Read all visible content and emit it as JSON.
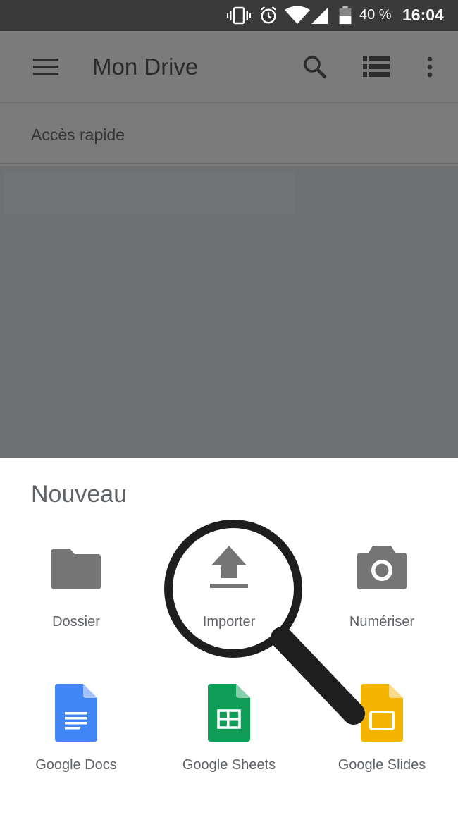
{
  "status_bar": {
    "battery_percent": "40 %",
    "time": "16:04",
    "icons": [
      "vibrate-icon",
      "alarm-icon",
      "wifi-icon",
      "cell-signal-icon",
      "battery-icon"
    ]
  },
  "toolbar": {
    "title": "Mon Drive",
    "icons": [
      "menu-icon",
      "search-icon",
      "list-view-icon",
      "more-vert-icon"
    ]
  },
  "quick_access": {
    "label": "Accès rapide"
  },
  "sheet": {
    "heading": "Nouveau",
    "options": [
      {
        "label": "Dossier",
        "icon": "folder-icon"
      },
      {
        "label": "Importer",
        "icon": "upload-icon"
      },
      {
        "label": "Numériser",
        "icon": "camera-icon"
      },
      {
        "label": "Google Docs",
        "icon": "google-docs-icon"
      },
      {
        "label": "Google Sheets",
        "icon": "google-sheets-icon"
      },
      {
        "label": "Google Slides",
        "icon": "google-slides-icon"
      }
    ]
  },
  "colors": {
    "status_bar": "#3a3a3a",
    "scrim": "#7a7a7b",
    "docs_blue": "#4285f4",
    "sheets_green": "#0f9d58",
    "slides_yellow": "#f4b400",
    "icon_gray": "#757575",
    "text_gray": "#5f6368"
  }
}
